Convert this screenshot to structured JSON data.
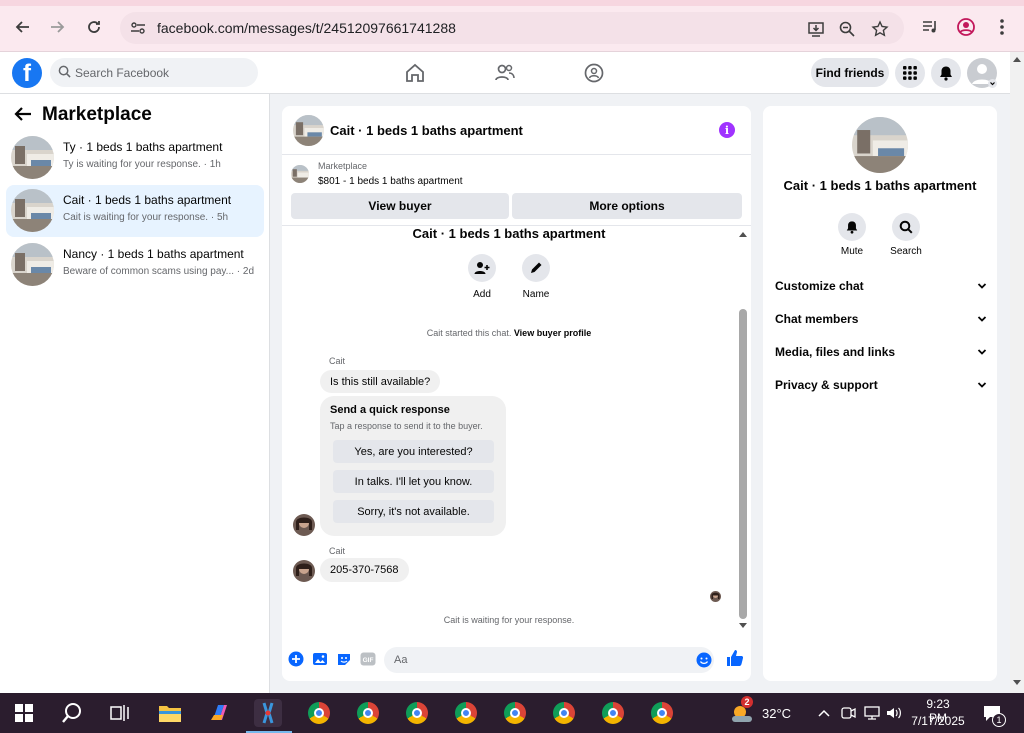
{
  "browser": {
    "url": "facebook.com/messages/t/24512097661741288"
  },
  "header": {
    "search_placeholder": "Search Facebook",
    "find_friends": "Find friends"
  },
  "sidebar": {
    "title": "Marketplace",
    "conversations": [
      {
        "name": "Ty · 1 beds 1 baths apartment",
        "preview": "Ty is waiting for your response. · 1h",
        "active": false
      },
      {
        "name": "Cait · 1 beds 1 baths apartment",
        "preview": "Cait is waiting for your response. · 5h",
        "active": true
      },
      {
        "name": "Nancy · 1 beds 1 baths apartment",
        "preview": "Beware of common scams using pay...  · 2d",
        "active": false
      }
    ]
  },
  "chat": {
    "title": "Cait · 1 beds 1 baths apartment",
    "listing_category": "Marketplace",
    "listing_price": "$801 - 1 beds 1 baths apartment",
    "view_buyer": "View buyer",
    "more_options": "More options",
    "thread_title": "Cait · 1 beds 1 baths apartment",
    "actions": {
      "add": "Add",
      "name": "Name"
    },
    "started_text": "Cait started this chat.",
    "view_buyer_profile": "View buyer profile",
    "sender_name_1": "Cait",
    "message_1": "Is this still available?",
    "quick_title": "Send a quick response",
    "quick_subtitle": "Tap a response to send it to the buyer.",
    "quick_replies": [
      "Yes, are you interested?",
      "In talks. I'll let you know.",
      "Sorry, it's not available."
    ],
    "sender_name_2": "Cait",
    "message_2": "205-370-7568",
    "waiting_text": "Cait is waiting for your response.",
    "composer_placeholder": "Aa"
  },
  "info": {
    "name": "Cait · 1 beds 1 baths apartment",
    "mute": "Mute",
    "search": "Search",
    "sections": [
      "Customize chat",
      "Chat members",
      "Media, files and links",
      "Privacy & support"
    ]
  },
  "taskbar": {
    "weather_badge": "2",
    "temperature": "32°C",
    "time": "9:23 PM",
    "date": "7/17/2025",
    "notification_count": "1"
  },
  "colors": {
    "brand": "#1877f2",
    "active_row": "#e7f3ff",
    "info_icon": "#a033ff"
  }
}
